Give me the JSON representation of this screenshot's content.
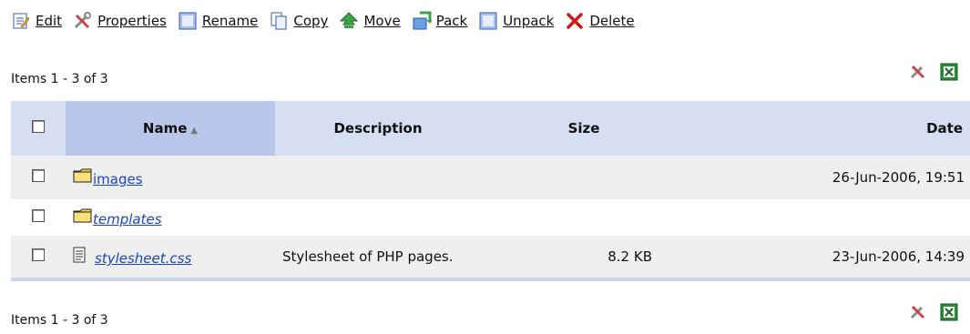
{
  "toolbar": {
    "items": [
      {
        "label": "Edit",
        "icon": "edit-icon"
      },
      {
        "label": "Properties",
        "icon": "tools-icon"
      },
      {
        "label": "Rename",
        "icon": "rename-icon"
      },
      {
        "label": "Copy",
        "icon": "copy-icon"
      },
      {
        "label": "Move",
        "icon": "move-icon"
      },
      {
        "label": "Pack",
        "icon": "pack-icon"
      },
      {
        "label": "Unpack",
        "icon": "unpack-icon"
      },
      {
        "label": "Delete",
        "icon": "delete-icon"
      }
    ]
  },
  "pager": {
    "top": "Items 1 - 3 of 3",
    "bottom": "Items 1 - 3 of 3"
  },
  "table": {
    "headers": {
      "name": "Name",
      "description": "Description",
      "size": "Size",
      "date": "Date"
    },
    "sort_indicator": "▲",
    "rows": [
      {
        "name": "images",
        "description": "",
        "size": "",
        "date": "26-Jun-2006, 19:51",
        "type": "folder"
      },
      {
        "name": "templates",
        "description": "",
        "size": "",
        "date": "",
        "type": "folder"
      },
      {
        "name": "stylesheet.css",
        "description": "Stylesheet of PHP pages.",
        "size": "8.2 KB",
        "date": "23-Jun-2006, 14:39",
        "type": "file"
      }
    ]
  },
  "colors": {
    "header_bg": "#d6dff2",
    "header_sorted_bg": "#b9c7ea",
    "row_alt_bg": "#efefef",
    "link": "#1a45c8"
  }
}
